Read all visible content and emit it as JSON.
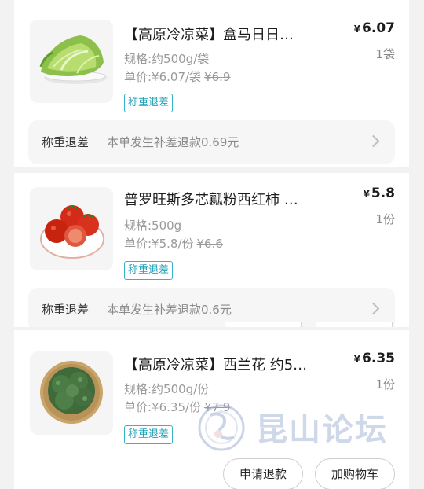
{
  "items": [
    {
      "title": "【高原冷凉菜】盒马日日…",
      "price": "6.07",
      "currency": "¥",
      "quantity": "1袋",
      "spec": "规格:约500g/袋",
      "unit_price_label": "单价:¥6.07/袋",
      "unit_price_original": "¥6.9",
      "badge": "称重退差",
      "image": "lettuce",
      "refund": {
        "label": "称重退差",
        "text": "本单发生补差退款0.69元"
      }
    },
    {
      "title": "普罗旺斯多芯瓤粉西红柿 …",
      "price": "5.8",
      "currency": "¥",
      "quantity": "1份",
      "spec": "规格:500g",
      "unit_price_label": "单价:¥5.8/份",
      "unit_price_original": "¥6.6",
      "badge": "称重退差",
      "image": "tomatoes",
      "refund": {
        "label": "称重退差",
        "text": "本单发生补差退款0.6元"
      }
    },
    {
      "title": "【高原冷凉菜】西兰花 约5…",
      "price": "6.35",
      "currency": "¥",
      "quantity": "1份",
      "spec": "规格:约500g/份",
      "unit_price_label": "单价:¥6.35/份",
      "unit_price_original": "¥7.9",
      "badge": "称重退差",
      "image": "broccoli"
    }
  ],
  "actions": {
    "refund_button": "申请退款",
    "add_to_cart_button": "加购物车"
  },
  "watermark": {
    "text": "昆山论坛"
  },
  "colors": {
    "badge": "#1f9fb6",
    "card": "#ffffff",
    "background": "#f2f2f2"
  }
}
